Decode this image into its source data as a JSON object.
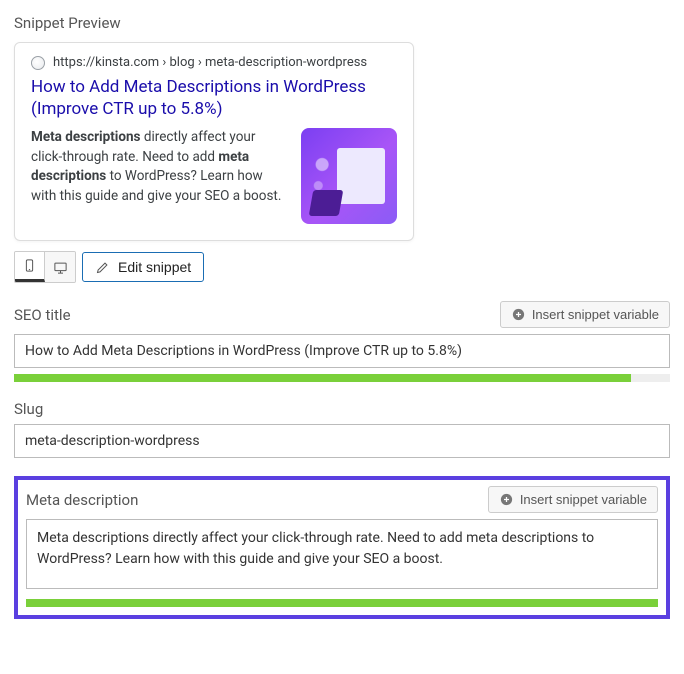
{
  "header": {
    "title": "Snippet Preview"
  },
  "preview": {
    "url": "https://kinsta.com › blog › meta-description-wordpress",
    "title": "How to Add Meta Descriptions in WordPress (Improve CTR up to 5.8%)",
    "desc_lead_bold": "Meta descriptions",
    "desc_part1": " directly affect your click-through rate. Need to add ",
    "desc_mid_bold": "meta descriptions",
    "desc_part2": " to WordPress? Learn how with this guide and give your SEO a boost."
  },
  "toolbar": {
    "edit_label": "Edit snippet"
  },
  "fields": {
    "seo_title": {
      "label": "SEO title",
      "value": "How to Add Meta Descriptions in WordPress (Improve CTR up to 5.8%)",
      "progress_pct": 94,
      "insert_label": "Insert snippet variable"
    },
    "slug": {
      "label": "Slug",
      "value": "meta-description-wordpress"
    },
    "meta_desc": {
      "label": "Meta description",
      "value": "Meta descriptions directly affect your click-through rate. Need to add meta descriptions to WordPress? Learn how with this guide and give your SEO a boost.",
      "progress_pct": 100,
      "insert_label": "Insert snippet variable"
    }
  }
}
